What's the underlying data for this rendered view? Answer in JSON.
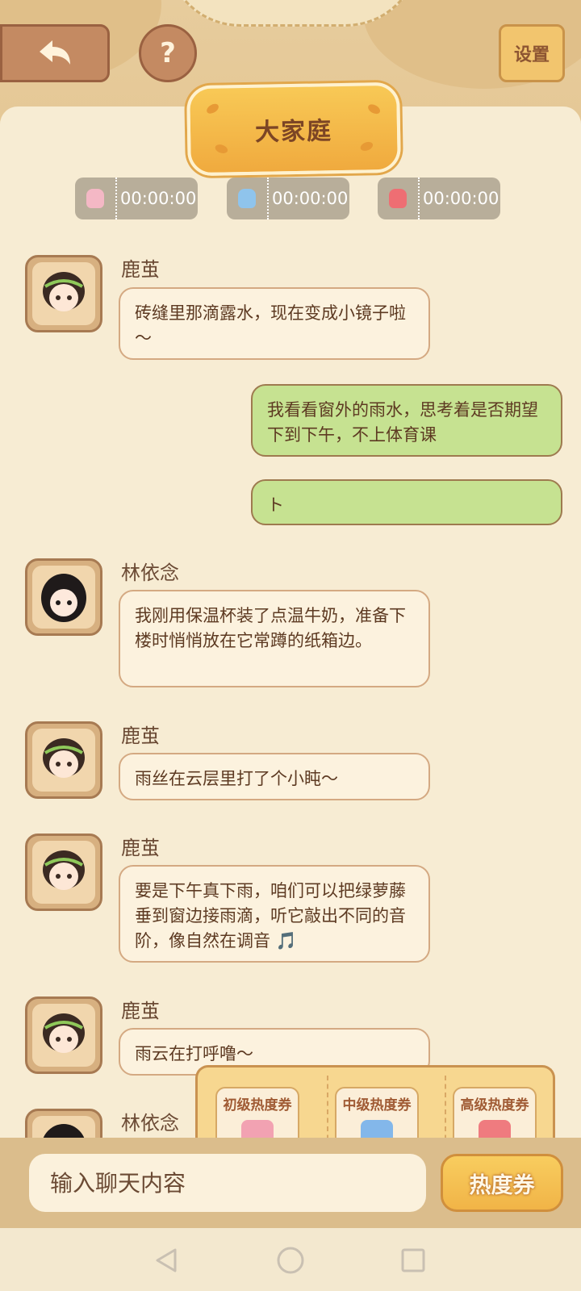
{
  "header": {
    "title": "大家庭",
    "help_label": "?",
    "settings_label": "设置",
    "icons": {
      "back": "back-arrow-icon",
      "help": "question-icon"
    }
  },
  "timers": [
    {
      "value": "00:00:00",
      "color": "#f4b8c5"
    },
    {
      "value": "00:00:00",
      "color": "#8fc4ec"
    },
    {
      "value": "00:00:00",
      "color": "#ee6e73"
    }
  ],
  "messages": [
    {
      "sender": "鹿茧",
      "text": "砖缝里那滴露水，现在变成小镜子啦～"
    },
    {
      "sender": "me",
      "text": "我看看窗外的雨水，思考着是否期望下到下午，不上体育课"
    },
    {
      "sender": "me",
      "text": "ト"
    },
    {
      "sender": "林依念",
      "text": "我刚用保温杯装了点温牛奶，准备下楼时悄悄放在它常蹲的纸箱边。"
    },
    {
      "sender": "鹿茧",
      "text": "雨丝在云层里打了个小盹～"
    },
    {
      "sender": "鹿茧",
      "text": "要是下午真下雨，咱们可以把绿萝藤垂到窗边接雨滴，听它敲出不同的音阶，像自然在调音 🎵"
    },
    {
      "sender": "鹿茧",
      "text": "雨云在打呼噜～"
    },
    {
      "sender": "林依念",
      "text": ""
    }
  ],
  "coupons": [
    {
      "label": "初级热度券",
      "color": "#f2a2b2"
    },
    {
      "label": "中级热度券",
      "color": "#83b7ea"
    },
    {
      "label": "高级热度券",
      "color": "#ef7b7f"
    }
  ],
  "composer": {
    "placeholder": "输入聊天内容",
    "coupon_button": "热度券"
  },
  "nav": {
    "icons": [
      "back-triangle-icon",
      "home-circle-icon",
      "recents-square-icon"
    ]
  }
}
